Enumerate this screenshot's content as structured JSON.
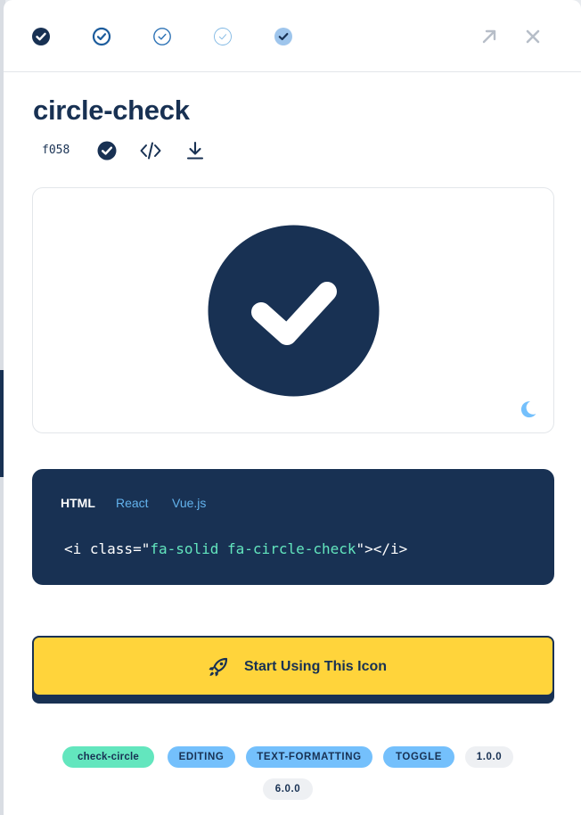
{
  "toolbar": {
    "style_buttons": [
      {
        "name": "style-solid",
        "color": "#183153"
      },
      {
        "name": "style-regular",
        "color": "#1c5c9c"
      },
      {
        "name": "style-light",
        "color": "#2d72b5"
      },
      {
        "name": "style-thin",
        "color": "#7fb7e3"
      },
      {
        "name": "style-duotone",
        "color": "#74a9e0"
      }
    ],
    "open_icon": "arrow-up-right-icon",
    "close_icon": "close-icon"
  },
  "icon": {
    "name": "circle-check",
    "unicode": "f058",
    "meta_icons": [
      "circle-check-icon",
      "code-icon",
      "download-icon"
    ]
  },
  "preview": {
    "icon": "circle-check-icon",
    "theme_toggle_icon": "moon-icon",
    "icon_color": "#183153"
  },
  "code": {
    "tabs": [
      "HTML",
      "React",
      "Vue.js"
    ],
    "active_tab": "HTML",
    "snippet_prefix": "<i class=\"",
    "snippet_class": "fa-solid fa-circle-check",
    "snippet_suffix": "\"></i>"
  },
  "cta": {
    "label": "Start Using This Icon",
    "icon": "rocket-icon"
  },
  "tags": [
    {
      "label": "check-circle"
    },
    {
      "label": "EDITING"
    },
    {
      "label": "TEXT-FORMATTING"
    },
    {
      "label": "TOGGLE"
    },
    {
      "label": "1.0.0"
    },
    {
      "label": "6.0.0"
    }
  ],
  "colors": {
    "navy": "#183153",
    "yellow": "#ffd43b",
    "teal": "#63e6be",
    "blue": "#74c0fc",
    "light_blue_text": "#63b3ed"
  }
}
